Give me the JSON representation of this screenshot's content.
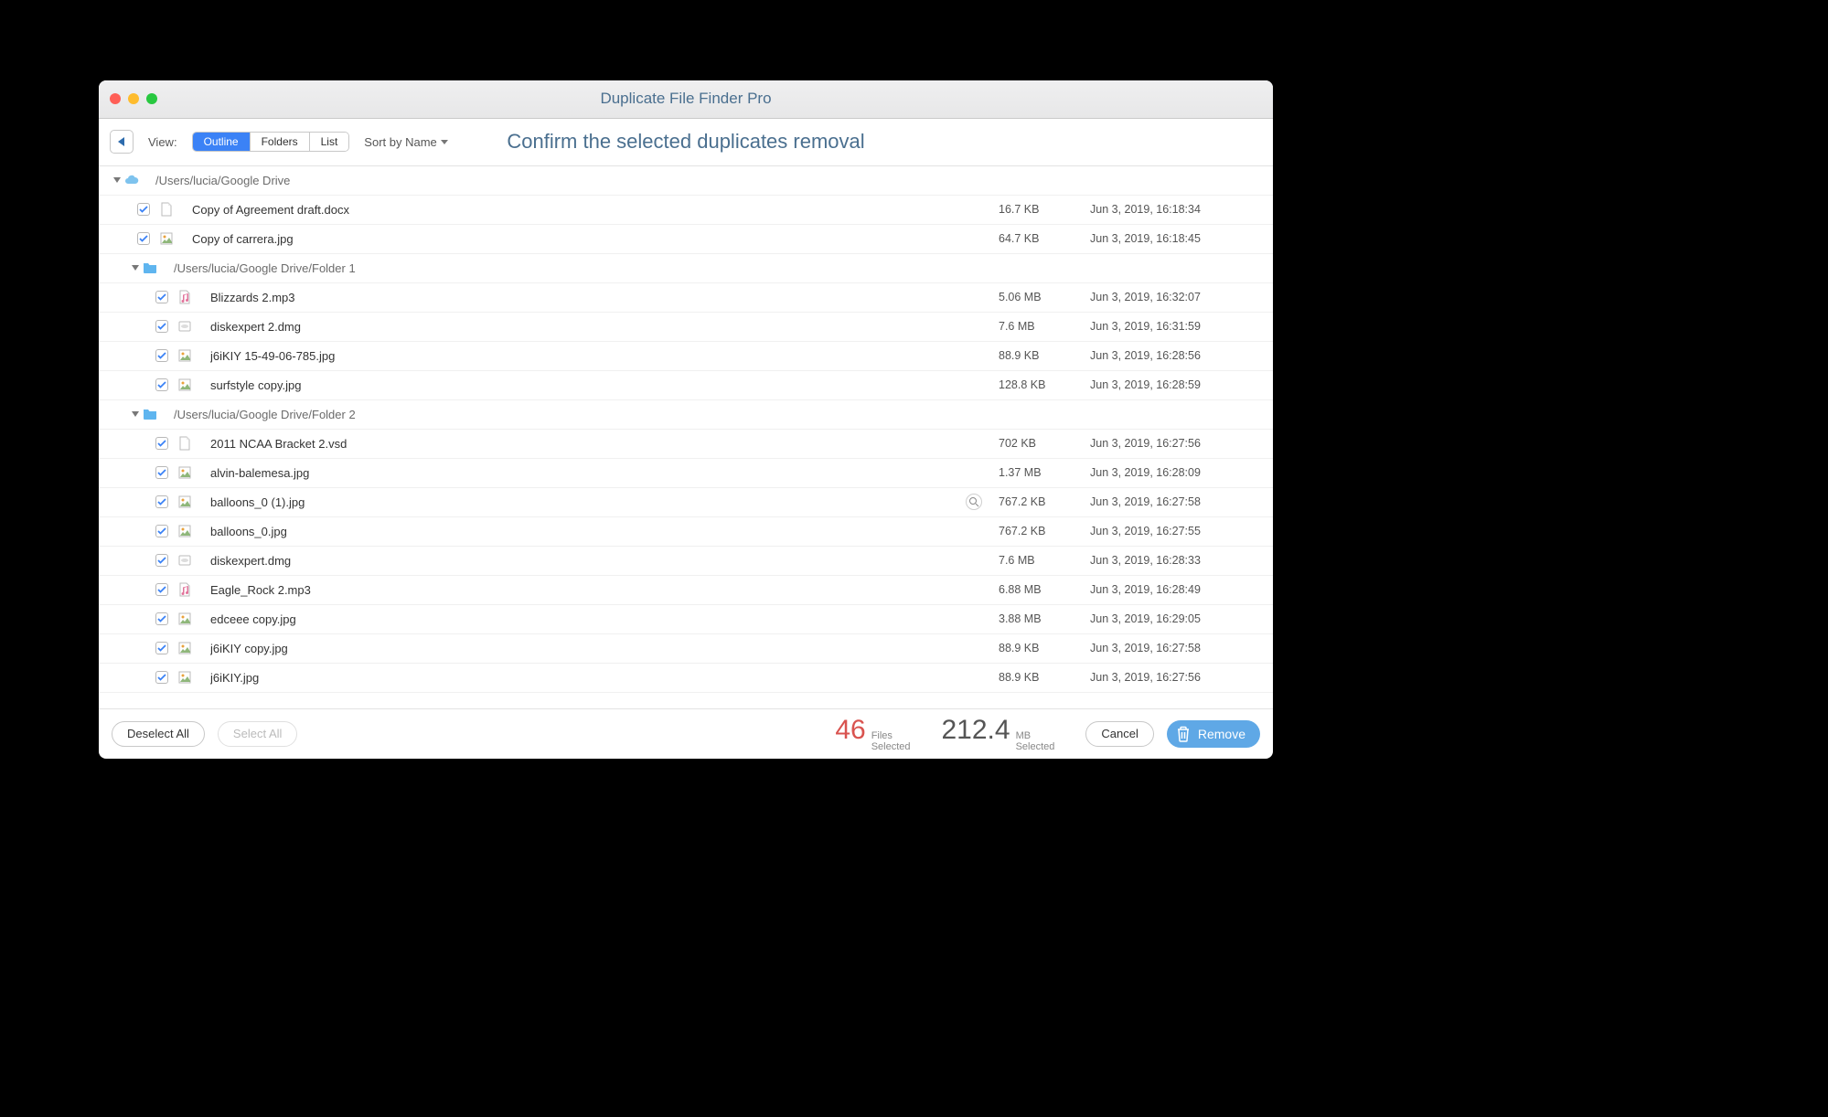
{
  "window": {
    "title": "Duplicate File Finder Pro"
  },
  "toolbar": {
    "view_label": "View:",
    "segments": [
      "Outline",
      "Folders",
      "List"
    ],
    "sort_label": "Sort by Name",
    "heading": "Confirm the selected duplicates removal"
  },
  "groups": [
    {
      "path": "/Users/lucia/Google Drive",
      "icon": "cloud",
      "files": [
        {
          "name": "Copy of Agreement draft.docx",
          "icon": "doc",
          "size": "16.7 KB",
          "date": "Jun 3, 2019, 16:18:34",
          "checked": true
        },
        {
          "name": "Copy of carrera.jpg",
          "icon": "img",
          "size": "64.7 KB",
          "date": "Jun 3, 2019, 16:18:45",
          "checked": true
        }
      ]
    },
    {
      "path": "/Users/lucia/Google Drive/Folder 1",
      "icon": "folder",
      "files": [
        {
          "name": "Blizzards 2.mp3",
          "icon": "audio",
          "size": "5.06 MB",
          "date": "Jun 3, 2019, 16:32:07",
          "checked": true
        },
        {
          "name": "diskexpert 2.dmg",
          "icon": "dmg",
          "size": "7.6 MB",
          "date": "Jun 3, 2019, 16:31:59",
          "checked": true
        },
        {
          "name": "j6iKIY 15-49-06-785.jpg",
          "icon": "img",
          "size": "88.9 KB",
          "date": "Jun 3, 2019, 16:28:56",
          "checked": true
        },
        {
          "name": "surfstyle copy.jpg",
          "icon": "img",
          "size": "128.8 KB",
          "date": "Jun 3, 2019, 16:28:59",
          "checked": true
        }
      ]
    },
    {
      "path": "/Users/lucia/Google Drive/Folder 2",
      "icon": "folder",
      "files": [
        {
          "name": "2011 NCAA Bracket 2.vsd",
          "icon": "doc",
          "size": "702 KB",
          "date": "Jun 3, 2019, 16:27:56",
          "checked": true
        },
        {
          "name": "alvin-balemesa.jpg",
          "icon": "img",
          "size": "1.37 MB",
          "date": "Jun 3, 2019, 16:28:09",
          "checked": true
        },
        {
          "name": "balloons_0 (1).jpg",
          "icon": "img",
          "size": "767.2 KB",
          "date": "Jun 3, 2019, 16:27:58",
          "checked": true,
          "magnify": true
        },
        {
          "name": "balloons_0.jpg",
          "icon": "img",
          "size": "767.2 KB",
          "date": "Jun 3, 2019, 16:27:55",
          "checked": true
        },
        {
          "name": "diskexpert.dmg",
          "icon": "dmg",
          "size": "7.6 MB",
          "date": "Jun 3, 2019, 16:28:33",
          "checked": true
        },
        {
          "name": "Eagle_Rock 2.mp3",
          "icon": "audio",
          "size": "6.88 MB",
          "date": "Jun 3, 2019, 16:28:49",
          "checked": true
        },
        {
          "name": "edceee copy.jpg",
          "icon": "img",
          "size": "3.88 MB",
          "date": "Jun 3, 2019, 16:29:05",
          "checked": true
        },
        {
          "name": "j6iKIY copy.jpg",
          "icon": "img",
          "size": "88.9 KB",
          "date": "Jun 3, 2019, 16:27:58",
          "checked": true
        },
        {
          "name": "j6iKIY.jpg",
          "icon": "img",
          "size": "88.9 KB",
          "date": "Jun 3, 2019, 16:27:56",
          "checked": true
        }
      ]
    }
  ],
  "footer": {
    "deselect_all": "Deselect All",
    "select_all": "Select All",
    "files_count": "46",
    "files_label_top": "Files",
    "files_label_bottom": "Selected",
    "size_value": "212.4",
    "size_label_top": "MB",
    "size_label_bottom": "Selected",
    "cancel": "Cancel",
    "remove": "Remove"
  }
}
